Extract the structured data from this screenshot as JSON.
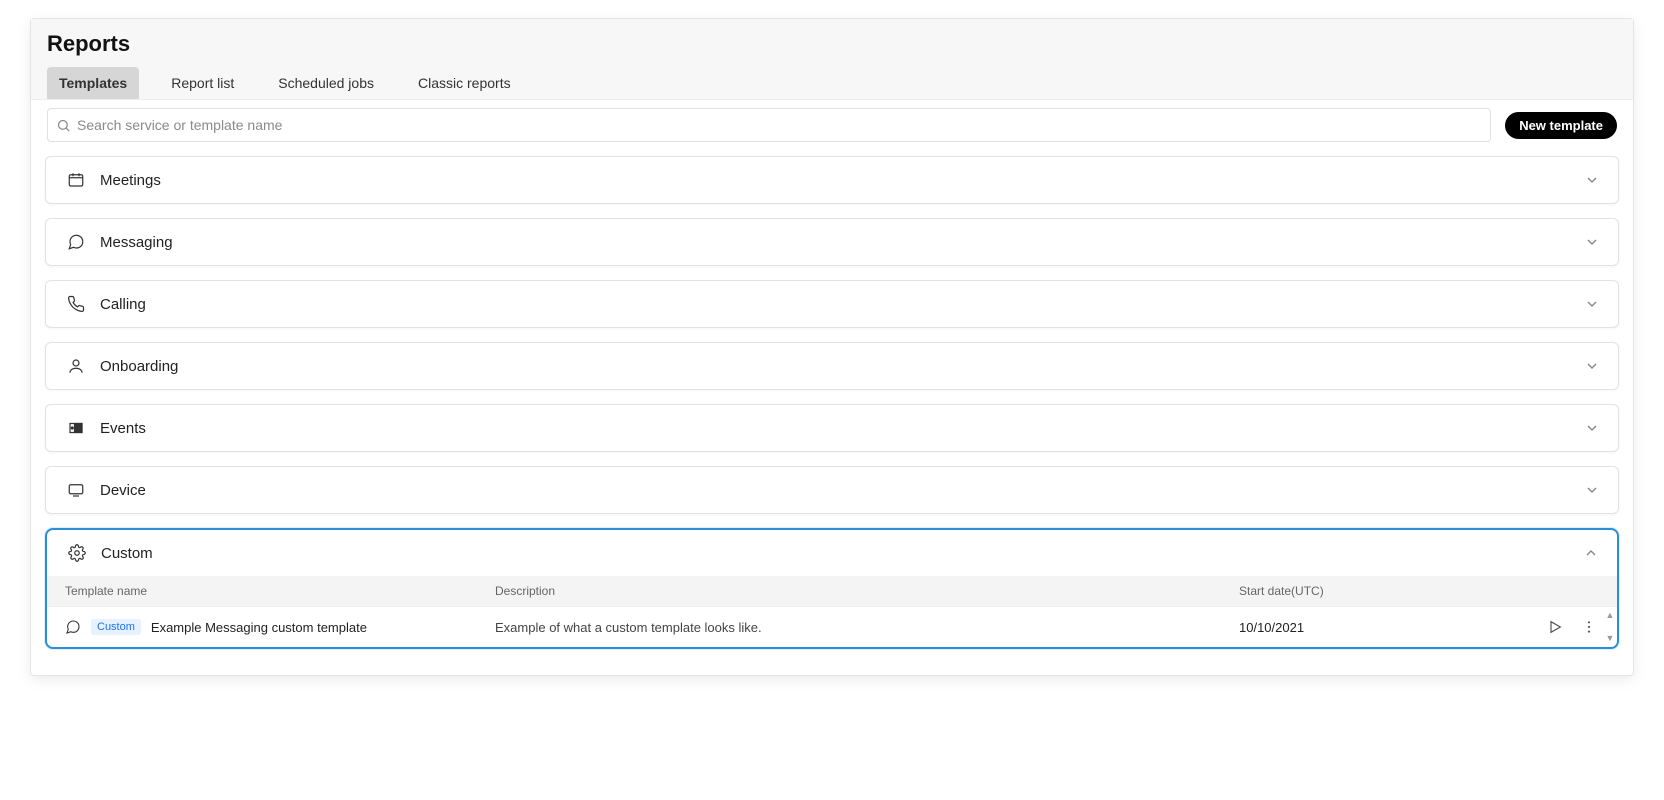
{
  "header": {
    "title": "Reports"
  },
  "tabs": [
    {
      "label": "Templates",
      "active": true
    },
    {
      "label": "Report list",
      "active": false
    },
    {
      "label": "Scheduled jobs",
      "active": false
    },
    {
      "label": "Classic reports",
      "active": false
    }
  ],
  "search": {
    "placeholder": "Search service or template name"
  },
  "buttons": {
    "new_template": "New template"
  },
  "sections": [
    {
      "id": "meetings",
      "label": "Meetings",
      "icon": "meetings-icon",
      "expanded": false
    },
    {
      "id": "messaging",
      "label": "Messaging",
      "icon": "messaging-icon",
      "expanded": false
    },
    {
      "id": "calling",
      "label": "Calling",
      "icon": "calling-icon",
      "expanded": false
    },
    {
      "id": "onboarding",
      "label": "Onboarding",
      "icon": "onboarding-icon",
      "expanded": false
    },
    {
      "id": "events",
      "label": "Events",
      "icon": "events-icon",
      "expanded": false
    },
    {
      "id": "device",
      "label": "Device",
      "icon": "device-icon",
      "expanded": false
    }
  ],
  "custom": {
    "label": "Custom",
    "columns": {
      "name": "Template name",
      "desc": "Description",
      "date": "Start date(UTC)"
    },
    "rows": [
      {
        "badge": "Custom",
        "name": "Example Messaging custom template",
        "desc": "Example of what a custom template looks like.",
        "date": "10/10/2021"
      }
    ]
  }
}
